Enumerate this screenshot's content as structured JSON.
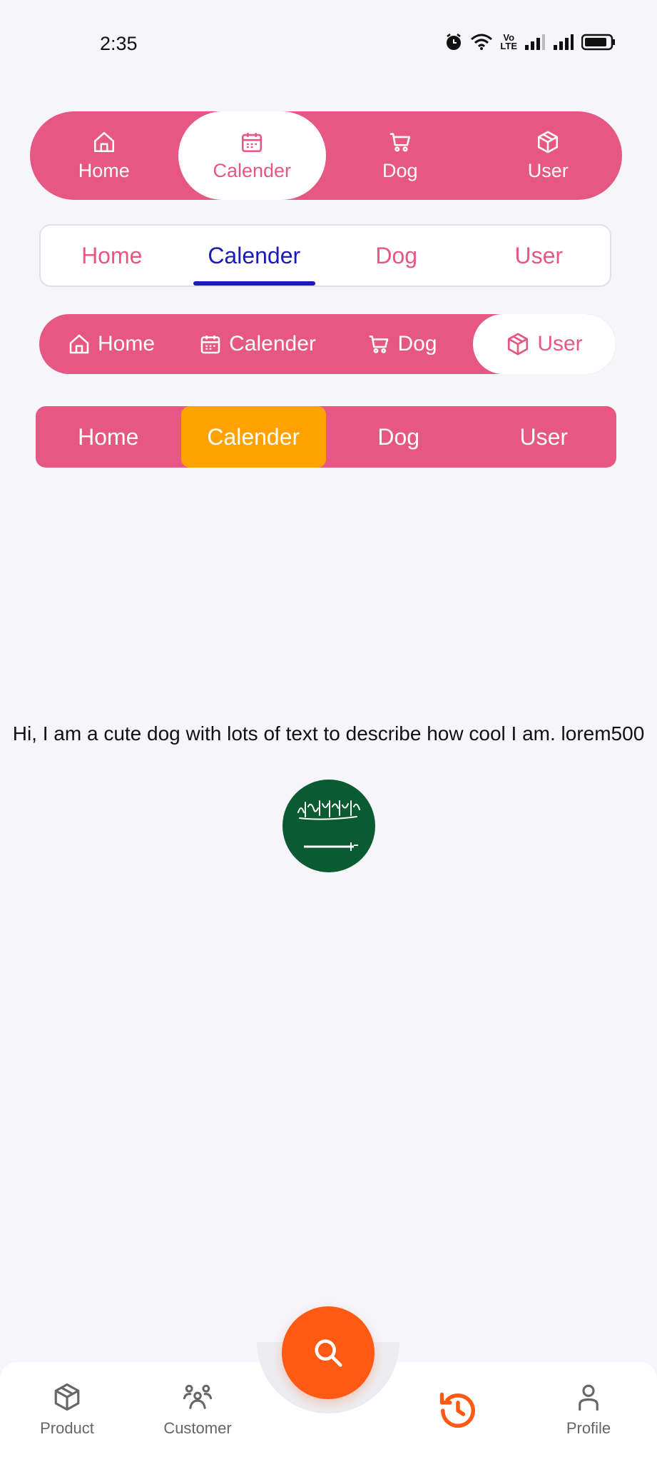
{
  "status_bar": {
    "time": "2:35",
    "volte": "Vo\nLTE"
  },
  "tabbar1": {
    "tabs": [
      {
        "label": "Home",
        "icon": "home-icon",
        "active": false
      },
      {
        "label": "Calender",
        "icon": "calendar-icon",
        "active": true
      },
      {
        "label": "Dog",
        "icon": "cart-icon",
        "active": false
      },
      {
        "label": "User",
        "icon": "cube-icon",
        "active": false
      }
    ],
    "accent": "#e75783"
  },
  "tabbar2": {
    "tabs": [
      "Home",
      "Calender",
      "Dog",
      "User"
    ],
    "active_index": 1,
    "indicator_color": "#1a1ab8"
  },
  "tabbar3": {
    "tabs": [
      "Home",
      "Calender",
      "Dog",
      "User"
    ],
    "active_index": 3
  },
  "tabbar4": {
    "tabs": [
      "Home",
      "Calender",
      "Dog",
      "User"
    ],
    "active_index": 1,
    "active_color": "#ffa200"
  },
  "description": "Hi, I am a cute dog with lots of text to describe how cool I am. lorem500",
  "avatar": {
    "icon": "saudi-flag-avatar"
  },
  "bottom_nav": {
    "items": [
      {
        "label": "Product",
        "icon": "cube-icon"
      },
      {
        "label": "Customer",
        "icon": "group-icon"
      },
      {
        "label": "",
        "icon": "history-icon",
        "active": true
      },
      {
        "label": "Profile",
        "icon": "person-icon"
      }
    ],
    "fab_icon": "search-icon",
    "fab_color": "#ff5a14"
  }
}
